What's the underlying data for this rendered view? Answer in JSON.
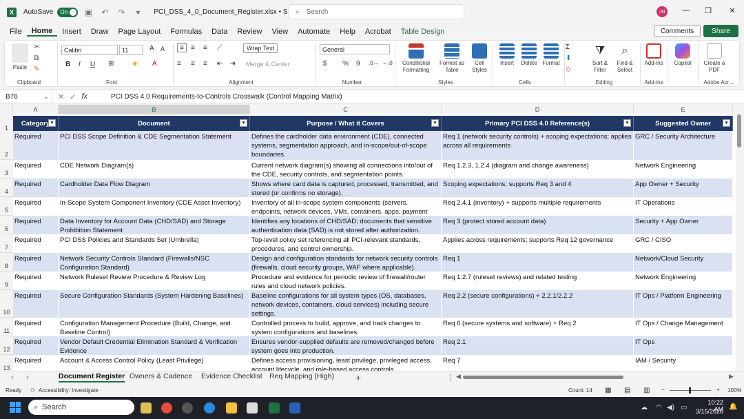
{
  "titlebar": {
    "autosave_label": "AutoSave",
    "autosave_state": "On",
    "filename": "PCI_DSS_4_0_Document_Register.xlsx • Saved",
    "search_placeholder": "Search",
    "user_initials": "JN"
  },
  "menu": [
    "File",
    "Home",
    "Insert",
    "Draw",
    "Page Layout",
    "Formulas",
    "Data",
    "Review",
    "View",
    "Automate",
    "Help",
    "Acrobat",
    "Table Design"
  ],
  "menu_active": "Home",
  "comments_label": "Comments",
  "share_label": "Share",
  "ribbon": {
    "clipboard": {
      "paste": "Paste",
      "label": "Clipboard"
    },
    "font": {
      "name": "Calibri",
      "size": "11",
      "label": "Font",
      "bold": "B",
      "italic": "I",
      "underline": "U"
    },
    "alignment": {
      "wrap": "Wrap Text",
      "merge": "Merge & Center",
      "label": "Alignment"
    },
    "number": {
      "format": "General",
      "label": "Number",
      "currency": "$",
      "percent": "%",
      "comma": "9"
    },
    "styles": {
      "conditional": "Conditional Formatting",
      "format_table": "Format as Table",
      "cell_styles": "Cell Styles",
      "label": "Styles"
    },
    "cells": {
      "insert": "Insert",
      "delete": "Delete",
      "format": "Format",
      "label": "Cells"
    },
    "editing": {
      "sort": "Sort & Filter",
      "find": "Find & Select",
      "label": "Editing"
    },
    "addins": {
      "addins": "Add-ins",
      "label": "Add-ins"
    },
    "copilot": {
      "label": "Copilot"
    },
    "adobe": {
      "create": "Create a PDF",
      "label": "Adobe Acr..."
    }
  },
  "formula_bar": {
    "cell_ref": "B76",
    "formula": "PCI DSS 4.0 Requirements-to-Controls Crosswalk (Control Mapping Matrix)"
  },
  "columns": [
    "A",
    "B",
    "C",
    "D",
    "E"
  ],
  "table_headers": [
    "Category",
    "Document",
    "Purpose / What it Covers",
    "Primary PCI DSS 4.0 Reference(s)",
    "Suggested Owner"
  ],
  "rows": [
    {
      "num": "2",
      "a": "Required",
      "b": "PCI DSS Scope Definition & CDE Segmentation Statement",
      "c": "Defines the cardholder data environment (CDE), connected systems, segmentation approach, and in-scope/out-of-scope boundaries.",
      "d": "Req 1 (network security controls) + scoping expectations; applies across all requirements",
      "e": "GRC / Security Architecture"
    },
    {
      "num": "3",
      "a": "Required",
      "b": "CDE Network Diagram(s)",
      "c": "Current network diagram(s) showing all connections into/out of the CDE, security controls, and segmentation points.",
      "d": "Req 1.2.3, 1.2.4 (diagram and change awareness)",
      "e": "Network Engineering"
    },
    {
      "num": "4",
      "a": "Required",
      "b": "Cardholder Data Flow Diagram",
      "c": "Shows where card data is captured, processed, transmitted, and stored (or confirms no storage).",
      "d": "Scoping expectations; supports Req 3 and 4",
      "e": "App Owner + Security"
    },
    {
      "num": "5",
      "a": "Required",
      "b": "In-Scope System Component Inventory (CDE Asset Inventory)",
      "c": "Inventory of all in-scope system components (servers, endpoints, network devices, VMs, containers, apps, payment terminals).",
      "d": "Req 2.4.1 (inventory) + supports multiple requirements",
      "e": "IT Operations"
    },
    {
      "num": "6",
      "a": "Required",
      "b": "Data Inventory for Account Data (CHD/SAD) and Storage Prohibition Statement",
      "c": "Identifies any locations of CHD/SAD; documents that sensitive authentication data (SAD) is not stored after authorization.",
      "d": "Req 3 (protect stored account data)",
      "e": "Security + App Owner"
    },
    {
      "num": "7",
      "a": "Required",
      "b": "PCI DSS Policies and Standards Set (Umbrella)",
      "c": "Top-level policy set referencing all PCI-relevant standards, procedures, and control ownership.",
      "d": "Applies across requirements; supports Req 12 governance",
      "e": "GRC / CISO"
    },
    {
      "num": "8",
      "a": "Required",
      "b": "Network Security Controls Standard (Firewalls/NSC Configuration Standard)",
      "c": "Design and configuration standards for network security controls (firewalls, cloud security groups, WAF where applicable).",
      "d": "Req 1",
      "e": "Network/Cloud Security"
    },
    {
      "num": "9",
      "a": "Required",
      "b": "Network Ruleset Review Procedure & Review Log",
      "c": "Procedure and evidence for periodic review of firewall/router rules and cloud network policies.",
      "d": "Req 1.2.7 (ruleset reviews) and related testing",
      "e": "Network Engineering"
    },
    {
      "num": "10",
      "a": "Required",
      "b": "Secure Configuration Standards (System Hardening Baselines)",
      "c": "Baseline configurations for all system types (OS, databases, network devices, containers, cloud services) including secure settings.",
      "d": "Req 2.2 (secure configurations) + 2.2.1/2.2.2",
      "e": "IT Ops / Platform Engineering"
    },
    {
      "num": "11",
      "a": "Required",
      "b": "Configuration Management Procedure (Build, Change, and Baseline Control)",
      "c": "Controlled process to build, approve, and track changes to system configurations and baselines.",
      "d": "Req 6 (secure systems and software) + Req 2",
      "e": "IT Ops / Change Management"
    },
    {
      "num": "12",
      "a": "Required",
      "b": "Vendor Default Credential Elimination Standard & Verification Evidence",
      "c": "Ensures vendor-supplied defaults are removed/changed before system goes into production.",
      "d": "Req 2.1",
      "e": "IT Ops"
    },
    {
      "num": "13",
      "a": "Required",
      "b": "Account & Access Control Policy (Least Privilege)",
      "c": "Defines access provisioning, least privilege, privileged access, account lifecycle, and role-based access controls.",
      "d": "Req 7",
      "e": "IAM / Security"
    }
  ],
  "row_header_num": "1",
  "sheet_tabs": [
    "Document Register",
    "Owners & Cadence",
    "Evidence Checklist",
    "Req Mapping (High)"
  ],
  "active_tab": "Document Register",
  "status": {
    "ready": "Ready",
    "accessibility": "Accessibility: Investigate",
    "count": "Count: 14",
    "zoom": "100%"
  },
  "taskbar": {
    "search": "Search",
    "time": "10:22 AM",
    "date": "3/15/2026"
  },
  "colors": {
    "header_bg": "#203864",
    "band": "#d9e1f2",
    "excel_green": "#1e7145"
  }
}
